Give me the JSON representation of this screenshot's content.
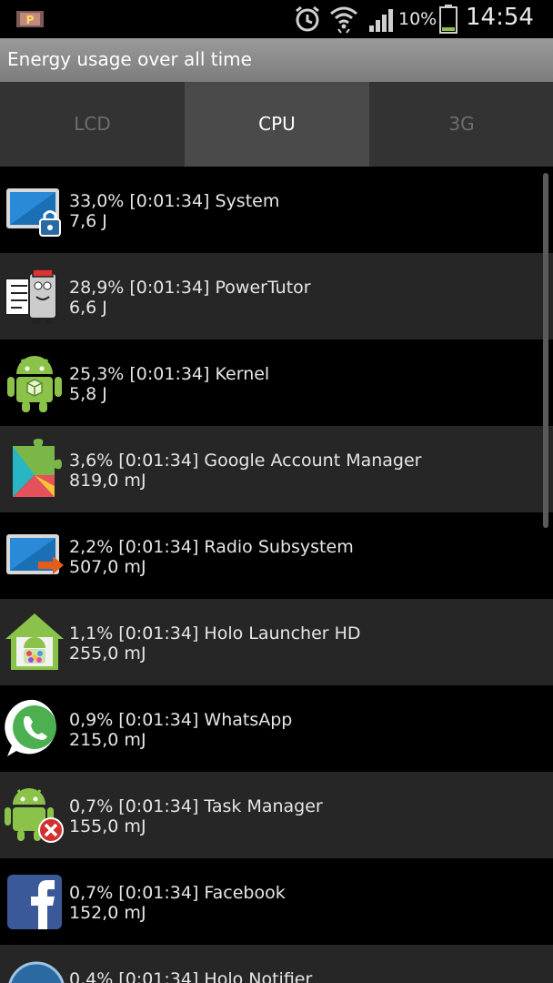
{
  "status_bar": {
    "battery_percent": "10%",
    "time": "14:54",
    "icons": [
      "notification-p-icon",
      "alarm-icon",
      "wifi-icon",
      "signal-icon",
      "battery-icon"
    ]
  },
  "title": "Energy usage over all time",
  "tabs": [
    {
      "label": "LCD",
      "active": false
    },
    {
      "label": "CPU",
      "active": true
    },
    {
      "label": "3G",
      "active": false
    }
  ],
  "apps": [
    {
      "name": "System",
      "line1": "33,0% [0:01:34] System",
      "line2": "7,6 J",
      "icon": "system-lock-icon"
    },
    {
      "name": "PowerTutor",
      "line1": "28,9% [0:01:34] PowerTutor",
      "line2": "6,6 J",
      "icon": "powertutor-icon"
    },
    {
      "name": "Kernel",
      "line1": "25,3% [0:01:34] Kernel",
      "line2": "5,8 J",
      "icon": "android-kernel-icon"
    },
    {
      "name": "Google Account Manager",
      "line1": "3,6% [0:01:34] Google Account Manager",
      "line2": "819,0 mJ",
      "icon": "google-play-services-icon"
    },
    {
      "name": "Radio Subsystem",
      "line1": "2,2% [0:01:34] Radio Subsystem",
      "line2": "507,0 mJ",
      "icon": "radio-subsystem-icon"
    },
    {
      "name": "Holo Launcher HD",
      "line1": "1,1% [0:01:34] Holo Launcher HD",
      "line2": "255,0 mJ",
      "icon": "holo-launcher-icon"
    },
    {
      "name": "WhatsApp",
      "line1": "0,9% [0:01:34] WhatsApp",
      "line2": "215,0 mJ",
      "icon": "whatsapp-icon"
    },
    {
      "name": "Task Manager",
      "line1": "0,7% [0:01:34] Task Manager",
      "line2": "155,0 mJ",
      "icon": "task-manager-icon"
    },
    {
      "name": "Facebook",
      "line1": "0,7% [0:01:34] Facebook",
      "line2": "152,0 mJ",
      "icon": "facebook-icon"
    },
    {
      "name": "Holo Notifier",
      "line1": "0,4% [0:01:34] Holo Notifier",
      "line2": "",
      "icon": "holo-notifier-icon"
    }
  ],
  "colors": {
    "accent": "#8bc34a",
    "tab_active_bg": "#4a4a4a",
    "row_alt_bg": "#262626"
  }
}
